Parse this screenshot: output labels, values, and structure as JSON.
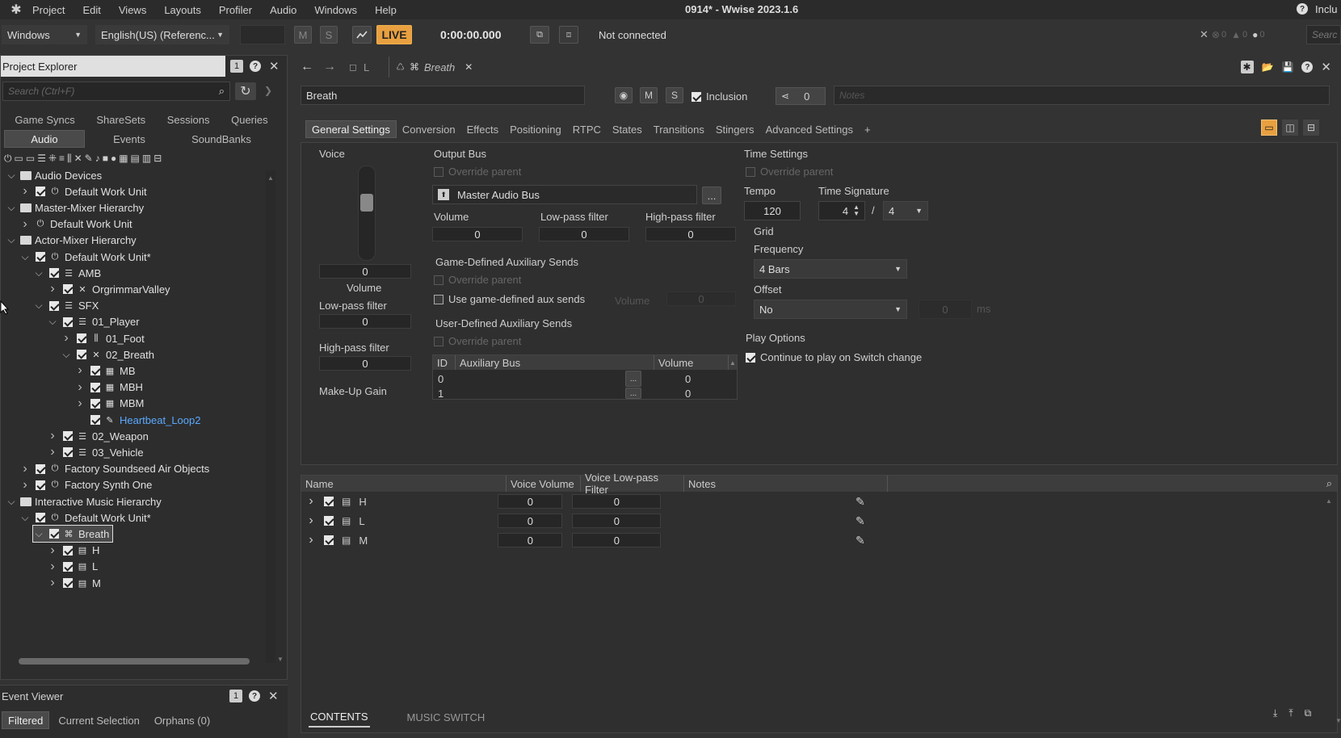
{
  "menubar": {
    "items": [
      "Project",
      "Edit",
      "Views",
      "Layouts",
      "Profiler",
      "Audio",
      "Windows",
      "Help"
    ],
    "title": "0914* - Wwise 2023.1.6",
    "right_label": "Inclu"
  },
  "toolbar": {
    "platform": "Windows",
    "language": "English(US) (Referenc...",
    "m_label": "M",
    "s_label": "S",
    "live_label": "LIVE",
    "time": "0:00:00.000",
    "connection": "Not connected",
    "error_count": "0",
    "warning_count": "0",
    "info_count": "0",
    "search_placeholder": "Searc"
  },
  "project_explorer": {
    "title": "Project Explorer",
    "badge": "1",
    "search_placeholder": "Search (Ctrl+F)",
    "tabs_row1": [
      "Game Syncs",
      "ShareSets",
      "Sessions",
      "Queries"
    ],
    "tabs_row2": [
      "Audio",
      "Events",
      "SoundBanks"
    ],
    "tree": [
      {
        "label": "Audio Devices",
        "indent": 0,
        "chev": "v",
        "type": "folder",
        "check": false
      },
      {
        "label": "Default Work Unit",
        "indent": 1,
        "chev": ">",
        "type": "wu",
        "check": true
      },
      {
        "label": "Master-Mixer Hierarchy",
        "indent": 0,
        "chev": "v",
        "type": "folder",
        "check": false
      },
      {
        "label": "Default Work Unit",
        "indent": 1,
        "chev": ">",
        "type": "wu",
        "check": false
      },
      {
        "label": "Actor-Mixer Hierarchy",
        "indent": 0,
        "chev": "v",
        "type": "folder",
        "check": false
      },
      {
        "label": "Default Work Unit*",
        "indent": 1,
        "chev": "v",
        "type": "wu",
        "check": true
      },
      {
        "label": "AMB",
        "indent": 2,
        "chev": "v",
        "type": "actor",
        "check": true
      },
      {
        "label": "OrgrimmarValley",
        "indent": 3,
        "chev": ">",
        "type": "random",
        "check": true
      },
      {
        "label": "SFX",
        "indent": 2,
        "chev": "v",
        "type": "actor",
        "check": true
      },
      {
        "label": "01_Player",
        "indent": 3,
        "chev": "v",
        "type": "actor",
        "check": true
      },
      {
        "label": "01_Foot",
        "indent": 4,
        "chev": ">",
        "type": "switch",
        "check": true
      },
      {
        "label": "02_Breath",
        "indent": 4,
        "chev": "v",
        "type": "random",
        "check": true
      },
      {
        "label": "MB",
        "indent": 5,
        "chev": ">",
        "type": "blend",
        "check": true
      },
      {
        "label": "MBH",
        "indent": 5,
        "chev": ">",
        "type": "blend",
        "check": true
      },
      {
        "label": "MBM",
        "indent": 5,
        "chev": ">",
        "type": "blend",
        "check": true
      },
      {
        "label": "Heartbeat_Loop2",
        "indent": 5,
        "chev": "",
        "type": "sound",
        "check": true,
        "link": true
      },
      {
        "label": "02_Weapon",
        "indent": 3,
        "chev": ">",
        "type": "actor",
        "check": true
      },
      {
        "label": "03_Vehicle",
        "indent": 3,
        "chev": ">",
        "type": "actor",
        "check": true
      },
      {
        "label": "Factory Soundseed Air Objects",
        "indent": 1,
        "chev": ">",
        "type": "wu",
        "check": true
      },
      {
        "label": "Factory Synth One",
        "indent": 1,
        "chev": ">",
        "type": "wu",
        "check": true
      },
      {
        "label": "Interactive Music Hierarchy",
        "indent": 0,
        "chev": "v",
        "type": "folder",
        "check": false
      },
      {
        "label": "Default Work Unit*",
        "indent": 1,
        "chev": "v",
        "type": "wu",
        "check": true
      },
      {
        "label": "Breath",
        "indent": 2,
        "chev": "v",
        "type": "musicswitch",
        "check": true,
        "selected": true
      },
      {
        "label": "H",
        "indent": 3,
        "chev": ">",
        "type": "playlist",
        "check": true
      },
      {
        "label": "L",
        "indent": 3,
        "chev": ">",
        "type": "playlist",
        "check": true
      },
      {
        "label": "M",
        "indent": 3,
        "chev": ">",
        "type": "playlist",
        "check": true
      }
    ]
  },
  "event_viewer": {
    "title": "Event Viewer",
    "badge": "1",
    "tabs": [
      "Filtered",
      "Current Selection",
      "Orphans (0)"
    ]
  },
  "editor": {
    "tab_l": "L",
    "tab_breath": "Breath",
    "object_name": "Breath",
    "m_label": "M",
    "s_label": "S",
    "inclusion_label": "Inclusion",
    "share_count": "0",
    "notes_placeholder": "Notes",
    "tabs": [
      "General Settings",
      "Conversion",
      "Effects",
      "Positioning",
      "RTPC",
      "States",
      "Transitions",
      "Stingers",
      "Advanced Settings",
      "+"
    ],
    "voice": {
      "title": "Voice",
      "volume_value": "0",
      "volume_label": "Volume",
      "lpf_label": "Low-pass filter",
      "lpf_value": "0",
      "hpf_label": "High-pass filter",
      "hpf_value": "0",
      "makeup_label": "Make-Up Gain"
    },
    "output_bus": {
      "title": "Output Bus",
      "override_label": "Override parent",
      "bus_name": "Master Audio Bus",
      "browse_label": "...",
      "volume_label": "Volume",
      "volume_value": "0",
      "lpf_label": "Low-pass filter",
      "lpf_value": "0",
      "hpf_label": "High-pass filter",
      "hpf_value": "0"
    },
    "game_aux": {
      "title": "Game-Defined Auxiliary Sends",
      "override_label": "Override parent",
      "use_label": "Use game-defined aux sends",
      "volume_label": "Volume",
      "volume_value": "0"
    },
    "user_aux": {
      "title": "User-Defined Auxiliary Sends",
      "override_label": "Override parent",
      "headers": [
        "ID",
        "Auxiliary Bus",
        "Volume"
      ],
      "rows": [
        {
          "id": "0",
          "bus": "",
          "volume": "0"
        },
        {
          "id": "1",
          "bus": "",
          "volume": "0"
        }
      ]
    },
    "time_settings": {
      "title": "Time Settings",
      "override_label": "Override parent",
      "tempo_label": "Tempo",
      "tempo_value": "120",
      "sig_label": "Time Signature",
      "sig_num": "4",
      "sig_sep": "/",
      "sig_den": "4",
      "grid_label": "Grid",
      "frequency_label": "Frequency",
      "frequency_value": "4 Bars",
      "offset_label": "Offset",
      "offset_value": "No",
      "offset_amount": "0",
      "offset_unit": "ms"
    },
    "play_options": {
      "title": "Play Options",
      "continue_label": "Continue to play on Switch change"
    }
  },
  "contents": {
    "headers": [
      "Name",
      "Voice Volume",
      "Voice Low-pass Filter",
      "Notes"
    ],
    "rows": [
      {
        "name": "H",
        "volume": "0",
        "lpf": "0"
      },
      {
        "name": "L",
        "volume": "0",
        "lpf": "0"
      },
      {
        "name": "M",
        "volume": "0",
        "lpf": "0"
      }
    ],
    "bottom_tabs": [
      "CONTENTS",
      "MUSIC SWITCH"
    ]
  }
}
